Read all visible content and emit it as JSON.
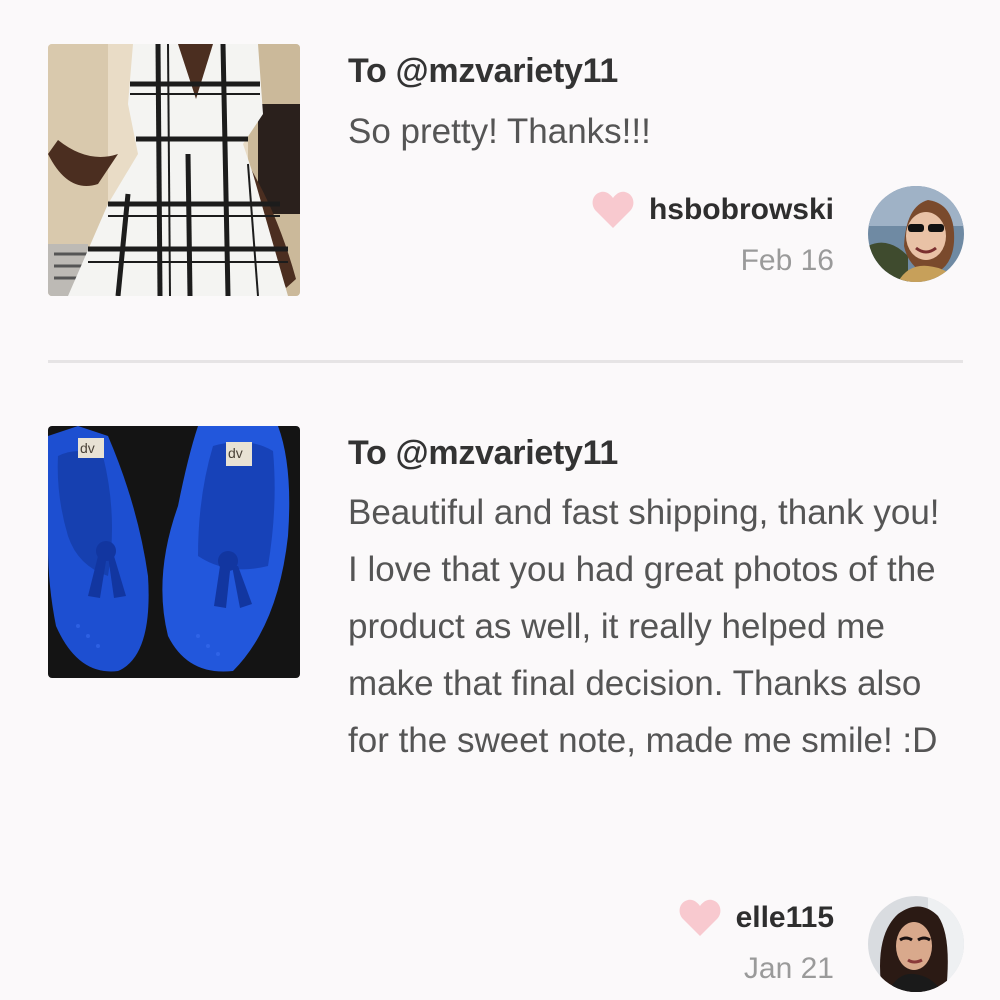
{
  "reviews": [
    {
      "recipient": "To @mzvariety11",
      "message": "So pretty! Thanks!!!",
      "username": "hsbobrowski",
      "date": "Feb 16",
      "thumbnail_icon": "dress-photo",
      "avatar_icon": "user-avatar-photo"
    },
    {
      "recipient": "To @mzvariety11",
      "message": "Beautiful and fast shipping, thank you! I love that you had great photos of the product as well, it really helped me make that final decision. Thanks also for the sweet note, made me smile! :D",
      "username": "elle115",
      "date": "Jan 21",
      "thumbnail_icon": "shoes-photo",
      "avatar_icon": "user-avatar-photo"
    }
  ],
  "colors": {
    "background": "#fbf9fa",
    "heart": "#f8c9cf",
    "username": "#2e2e2e",
    "date": "#9a9a9a",
    "message": "#555555",
    "divider": "#e6e4e5"
  }
}
